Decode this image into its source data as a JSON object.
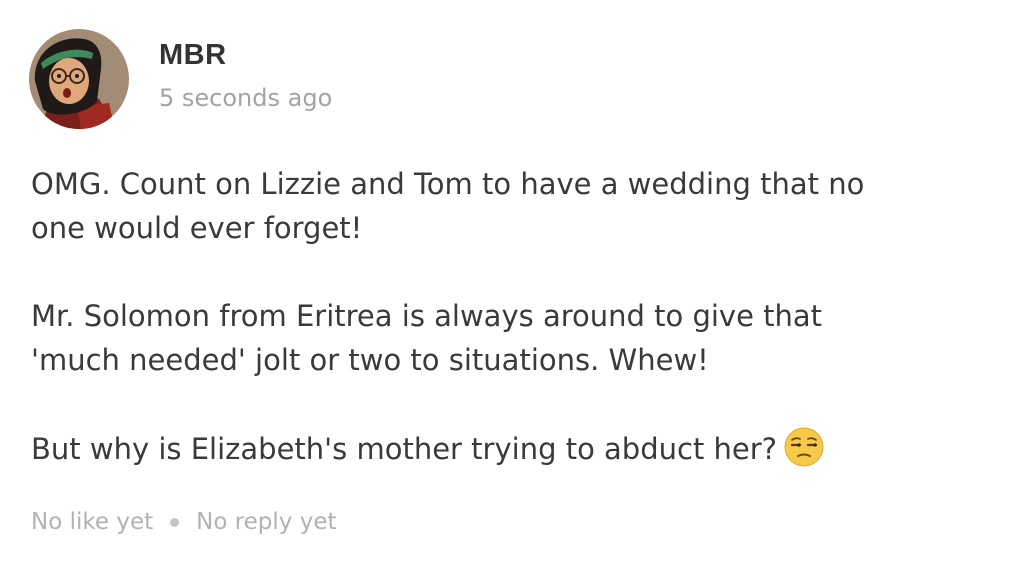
{
  "author": {
    "name": "MBR",
    "timestamp": "5 seconds ago",
    "avatar_icon": "cartoon-avatar-icon"
  },
  "comment": {
    "paragraphs": [
      "OMG. Count on Lizzie and Tom to have a wedding that no one would ever forget!",
      "Mr. Solomon from Eritrea is always around to give that 'much needed' jolt or two to situations. Whew!",
      "But why is Elizabeth's mother trying to abduct her?"
    ],
    "line1a": "OMG. Count on Lizzie and Tom to have a wedding that no",
    "line1b": "one would ever forget!",
    "line2a": "Mr. Solomon from Eritrea is always around to give that",
    "line2b": "'much needed' jolt or two to situations. Whew!",
    "line3": "But why is Elizabeth's mother trying to abduct her?",
    "emoji": "unamused-face-icon"
  },
  "footer": {
    "likes": "No like yet",
    "replies": "No reply yet"
  },
  "colors": {
    "text": "#3a3a3a",
    "muted": "#a3a3a3",
    "emoji_yellow": "#f7c948"
  }
}
